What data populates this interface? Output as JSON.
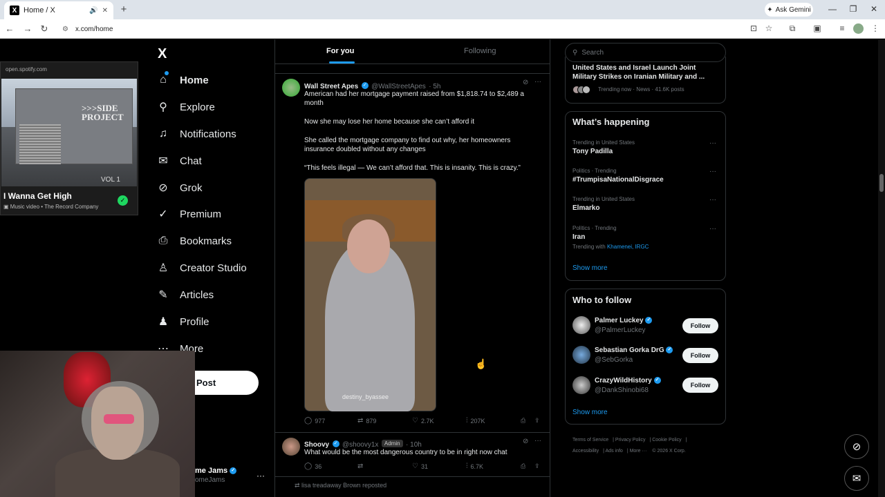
{
  "browser": {
    "tab_title": "Home / X",
    "favicon": "X",
    "url": "x.com/home",
    "gemini": "Ask Gemini"
  },
  "spotify": {
    "url": "open.spotify.com",
    "album_text": ">>>SIDE PROJECT",
    "vol": "VOL 1",
    "title": "I Wanna Get High",
    "subtitle": "Music video • The Record Company"
  },
  "nav": {
    "logo": "X",
    "items": [
      {
        "label": "Home",
        "icon": "home-icon"
      },
      {
        "label": "Explore",
        "icon": "search-icon"
      },
      {
        "label": "Notifications",
        "icon": "bell-icon"
      },
      {
        "label": "Chat",
        "icon": "mail-icon"
      },
      {
        "label": "Grok",
        "icon": "grok-icon"
      },
      {
        "label": "Premium",
        "icon": "verified-icon"
      },
      {
        "label": "Bookmarks",
        "icon": "bookmark-icon"
      },
      {
        "label": "Creator Studio",
        "icon": "creator-icon"
      },
      {
        "label": "Articles",
        "icon": "articles-icon"
      },
      {
        "label": "Profile",
        "icon": "person-icon"
      },
      {
        "label": "More",
        "icon": "more-icon"
      }
    ],
    "post": "Post",
    "account_name": "me Jams",
    "account_handle": "omeJams"
  },
  "feed": {
    "tabs": [
      "For you",
      "Following"
    ],
    "tweet1": {
      "name": "Wall Street Apes",
      "handle": "@WallStreetApes",
      "time": "· 5h",
      "paragraphs": [
        "American had her mortgage payment raised from $1,818.74 to $2,489 a month",
        "Now she may lose her home because she can’t afford it",
        "She called the mortgage company to find out why, her homeowners insurance doubled without any changes",
        "“This feels illegal — We can’t afford that. This is insanity. This is crazy.”"
      ],
      "media_caption": "destiny_byassee",
      "replies": "977",
      "reposts": "879",
      "likes": "2.7K",
      "views": "207K"
    },
    "tweet2": {
      "name": "Shoovy",
      "handle": "@shoovy1x",
      "badge": "Admin",
      "time": "· 10h",
      "text": "What would be the most dangerous country to be in right now chat",
      "replies": "36",
      "likes": "31",
      "views": "6.7K"
    },
    "repost_note": "lisa treadaway Brown reposted"
  },
  "right": {
    "search_placeholder": "Search",
    "news": {
      "title": "United States and Israel Launch Joint Military Strikes on Iranian Military and ...",
      "meta": "Trending now · News · 41.6K posts"
    },
    "happening_title": "What’s happening",
    "trends": [
      {
        "context": "Trending in United States",
        "name": "Tony Padilla"
      },
      {
        "context": "Politics · Trending",
        "name": "#TrumpisaNationalDisgrace"
      },
      {
        "context": "Trending in United States",
        "name": "Elmarko"
      },
      {
        "context": "Politics · Trending",
        "name": "Iran",
        "extra_label": "Trending with",
        "extra_links": "Khamenei, IRGC"
      }
    ],
    "show_more": "Show more",
    "who_title": "Who to follow",
    "follow": [
      {
        "name": "Palmer Luckey",
        "handle": "@PalmerLuckey",
        "button": "Follow"
      },
      {
        "name": "Sebastian Gorka DrG",
        "handle": "@SebGorka",
        "button": "Follow"
      },
      {
        "name": "CrazyWildHistory",
        "handle": "@DankShinobi68",
        "button": "Follow"
      }
    ],
    "footer": [
      "Terms of Service",
      "Privacy Policy",
      "Cookie Policy",
      "Accessibility",
      "Ads info",
      "More ···",
      "© 2026 X Corp."
    ]
  },
  "colors": {
    "accent": "#1d9bf0",
    "bg": "#000000",
    "border": "#2f3336",
    "muted": "#71767b"
  }
}
